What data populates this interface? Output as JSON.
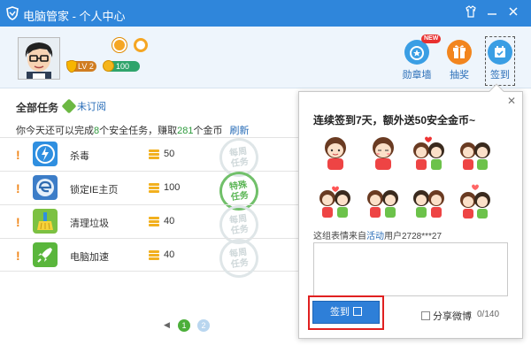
{
  "app": {
    "title": "电脑管家 - 个人中心"
  },
  "colors": {
    "title_bar": "#2f86db",
    "accent_link": "#2a6eb8",
    "highlight_green": "#2d9a3c",
    "red_outline": "#e02020"
  },
  "user": {
    "level": "LV 2",
    "coins": "100"
  },
  "header": {
    "medal_wall": {
      "label": "勋章墙",
      "badge": "NEW"
    },
    "lottery": {
      "label": "抽奖"
    },
    "sign_in": {
      "label": "签到"
    }
  },
  "tasks": {
    "heading": "全部任务",
    "unsubscribed": "未订阅",
    "summary": {
      "prefix": "你今天还可以完成",
      "count": "8",
      "mid": "个安全任务，赚取",
      "coins": "281",
      "suffix": "个金币",
      "refresh": "刷新"
    },
    "rows": [
      {
        "icon": "shield-lightning-icon",
        "name": "杀毒",
        "coins": "50",
        "stamp": "每周\n任务",
        "stamp_color": "gray"
      },
      {
        "icon": "ie-lock-icon",
        "name": "锁定IE主页",
        "coins": "100",
        "stamp": "特殊\n任务",
        "stamp_color": "green"
      },
      {
        "icon": "broom-icon",
        "name": "清理垃圾",
        "coins": "40",
        "stamp": "每周\n任务",
        "stamp_color": "gray"
      },
      {
        "icon": "rocket-icon",
        "name": "电脑加速",
        "coins": "40",
        "stamp": "每周\n任务",
        "stamp_color": "gray"
      }
    ],
    "pagination": {
      "pages": [
        "1",
        "2"
      ],
      "current": "1"
    }
  },
  "popup": {
    "title": "连续签到7天，额外送50安全金币~",
    "credit": {
      "prefix": "这组表情来自",
      "link": "活动",
      "suffix": "用户2728***27"
    },
    "sign_button": "签到",
    "share_label": "分享微博",
    "char_count": "0/140"
  }
}
